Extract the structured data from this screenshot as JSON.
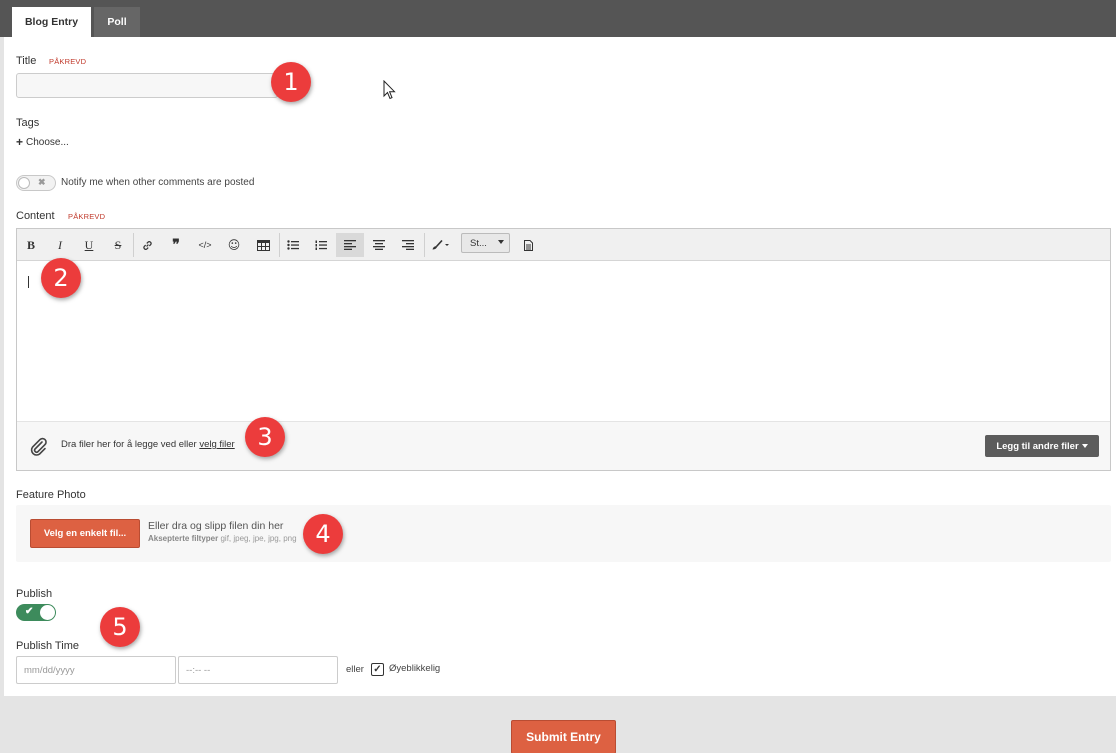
{
  "tabs": [
    {
      "label": "Blog Entry",
      "active": true
    },
    {
      "label": "Poll",
      "active": false
    }
  ],
  "form": {
    "title_label": "Title",
    "required_tag": "PÅKREVD",
    "title_value": "",
    "tags_label": "Tags",
    "tags_choose": "Choose...",
    "notify_label": "Notify me when other comments are posted",
    "notify_on": false,
    "content_label": "Content",
    "toolbar": {
      "style_label": "St..."
    },
    "attach_text_pre": "Dra filer her for å legge ved eller ",
    "attach_link": "velg filer",
    "attach_button": "Legg til andre filer",
    "feature_photo_label": "Feature Photo",
    "photo_button": "Velg en enkelt fil...",
    "photo_drop_text": "Eller dra og slipp filen din her",
    "photo_types_label": "Aksepterte filtyper",
    "photo_types_value": "gif, jpeg, jpe, jpg, png",
    "publish_label": "Publish",
    "publish_on": true,
    "publish_time_label": "Publish Time",
    "date_placeholder": "mm/dd/yyyy",
    "time_placeholder": "--:-- --",
    "or_label": "eller",
    "immediately_label": "Øyeblikkelig",
    "immediately_checked": true,
    "submit_label": "Submit Entry"
  },
  "annotations": [
    "1",
    "2",
    "3",
    "4",
    "5"
  ],
  "colors": {
    "accent": "#dd6142",
    "toggle_on": "#3d8b5c",
    "badge": "#ec3c3c",
    "required": "#c0392b"
  }
}
